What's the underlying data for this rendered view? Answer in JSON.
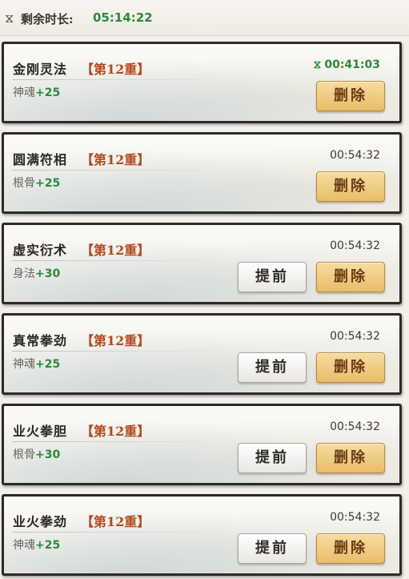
{
  "header": {
    "label": "剩余时长:",
    "remaining": "05:14:22"
  },
  "cards": [
    {
      "name": "金刚灵法",
      "tier": "【第12重】",
      "stat_name": "神魂",
      "stat_value": "+25",
      "timer": "00:41:03",
      "active": true,
      "delete_label": "删除",
      "advance_label": ""
    },
    {
      "name": "圆满符相",
      "tier": "【第12重】",
      "stat_name": "根骨",
      "stat_value": "+25",
      "timer": "00:54:32",
      "active": false,
      "delete_label": "删除",
      "advance_label": ""
    },
    {
      "name": "虚实衍术",
      "tier": "【第12重】",
      "stat_name": "身法",
      "stat_value": "+30",
      "timer": "00:54:32",
      "active": false,
      "delete_label": "删除",
      "advance_label": "提前"
    },
    {
      "name": "真常拳劲",
      "tier": "【第12重】",
      "stat_name": "神魂",
      "stat_value": "+25",
      "timer": "00:54:32",
      "active": false,
      "delete_label": "删除",
      "advance_label": "提前"
    },
    {
      "name": "业火拳胆",
      "tier": "【第12重】",
      "stat_name": "根骨",
      "stat_value": "+30",
      "timer": "00:54:32",
      "active": false,
      "delete_label": "删除",
      "advance_label": "提前"
    },
    {
      "name": "业火拳劲",
      "tier": "【第12重】",
      "stat_name": "神魂",
      "stat_value": "+25",
      "timer": "00:54:32",
      "active": false,
      "delete_label": "删除",
      "advance_label": "提前"
    }
  ]
}
